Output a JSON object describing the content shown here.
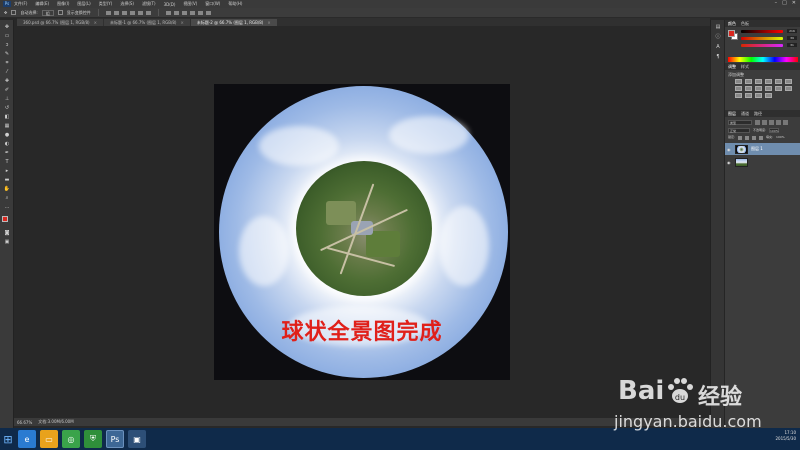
{
  "app": {
    "name": "Ps"
  },
  "menubar": {
    "items": [
      "文件(F)",
      "编辑(E)",
      "图像(I)",
      "图层(L)",
      "类型(Y)",
      "选择(S)",
      "滤镜(T)",
      "3D(D)",
      "视图(V)",
      "窗口(W)",
      "帮助(H)"
    ]
  },
  "options": {
    "auto_select": "自动选择:",
    "layer_select": "组",
    "show_transform": "显示变换控件"
  },
  "tabs": [
    {
      "label": "360.psd @ 66.7% (图层 1, RGB/8)",
      "active": false
    },
    {
      "label": "未标题-1 @ 66.7% (图层 1, RGB/8)",
      "active": false
    },
    {
      "label": "未标题-2 @ 66.7% (图层 1, RGB/8)",
      "active": true
    }
  ],
  "document": {
    "caption": "球状全景图完成"
  },
  "status": {
    "zoom": "66.67%",
    "doc": "文档:3.00M/6.00M"
  },
  "panels": {
    "color_tabs": [
      "颜色",
      "色板"
    ],
    "adjust_tabs": [
      "调整",
      "样式"
    ],
    "adjust_title": "添加调整",
    "layers_tabs": [
      "图层",
      "通道",
      "路径"
    ],
    "kind": "类型",
    "blend": "正常",
    "opacity_label": "不透明度:",
    "opacity": "100%",
    "lock_label": "锁定:",
    "fill_label": "填充:",
    "fill": "100%",
    "layers": [
      {
        "name": "图层 1",
        "selected": true
      },
      {
        "name": "",
        "selected": false
      }
    ],
    "slider_values": [
      "216",
      "39",
      "31"
    ]
  },
  "taskbar": {
    "time": "17:10",
    "date": "2015/5/30"
  },
  "watermark": {
    "brand": "Bai",
    "brand2": "经验",
    "url": "jingyan.baidu.com"
  },
  "colors": {
    "foreground": "#d8271f",
    "caption": "#e0201a",
    "taskbar": "#0f2a4a"
  }
}
